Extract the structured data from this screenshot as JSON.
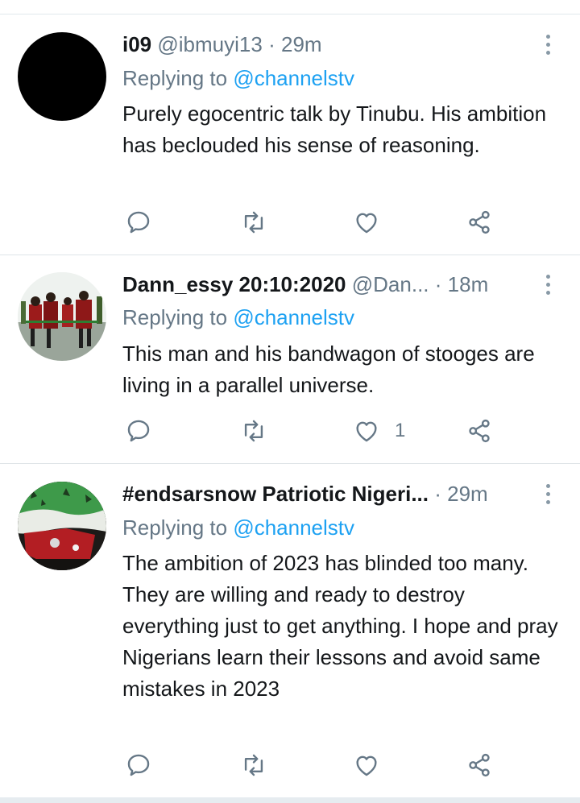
{
  "tweets": [
    {
      "name": "i09",
      "handle": "@ibmuyi13",
      "separator": "·",
      "time": "29m",
      "replying_prefix": "Replying to",
      "replying_to": "@channelstv",
      "text": "Purely egocentric talk by Tinubu. His ambition has beclouded his sense of reasoning.",
      "like_count": ""
    },
    {
      "name": "Dann_essy 20:10:2020",
      "handle": "@Dan...",
      "separator": "·",
      "time": "18m",
      "replying_prefix": "Replying to",
      "replying_to": "@channelstv",
      "text": "This man and his bandwagon of stooges are living in a parallel universe.",
      "like_count": "1"
    },
    {
      "name": "#endsarsnow Patriotic Nigeri...",
      "handle": "",
      "separator": "·",
      "time": "29m",
      "replying_prefix": "Replying to",
      "replying_to": "@channelstv",
      "text": "The ambition of 2023 has blinded too many. They are willing and ready to destroy everything just to get anything. I hope and pray Nigerians learn their lessons and avoid same mistakes in 2023",
      "like_count": ""
    }
  ],
  "colors": {
    "link": "#1da1f2",
    "secondary_text": "#657786",
    "icon": "#657786",
    "divider": "#dfe4e8"
  },
  "icons": [
    "reply-icon",
    "retweet-icon",
    "like-icon",
    "share-icon",
    "more-options-icon"
  ]
}
